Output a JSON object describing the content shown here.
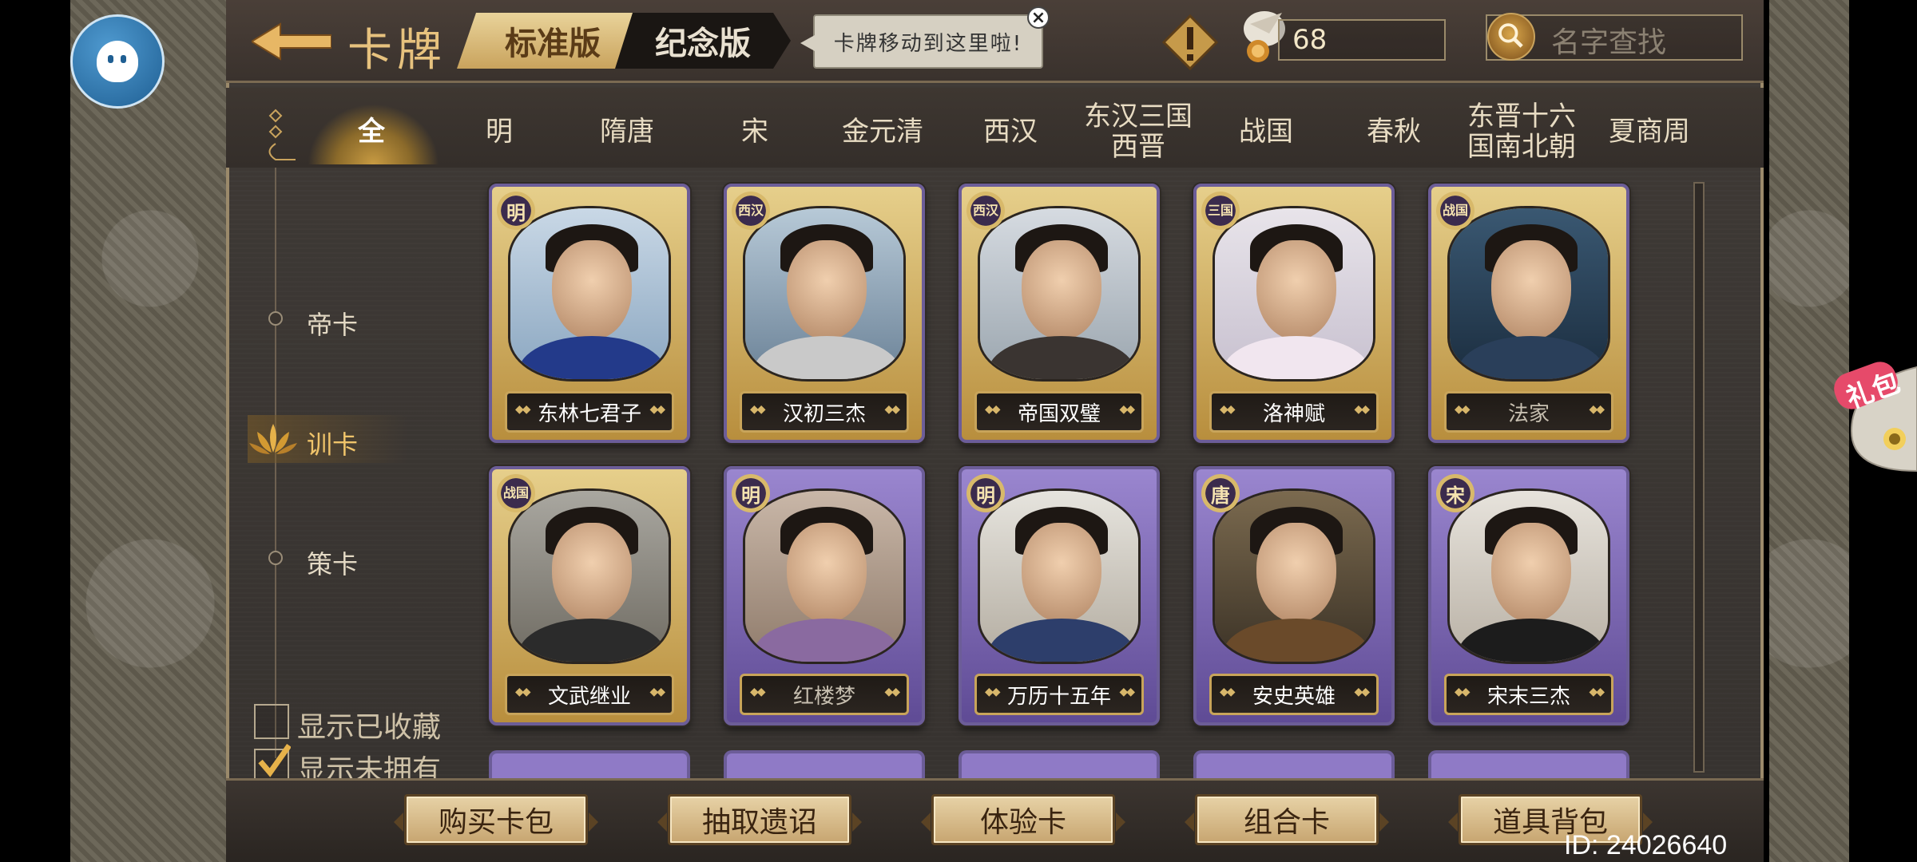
{
  "header": {
    "title": "卡牌",
    "tab_standard": "标准版",
    "tab_memorial": "纪念版",
    "tooltip": "卡牌移动到这里啦!",
    "currency_value": "68",
    "search_placeholder": "名字查找"
  },
  "dynasty_tabs": [
    "全",
    "明",
    "隋唐",
    "宋",
    "金元清",
    "西汉",
    "东汉三国\n西晋",
    "战国",
    "春秋",
    "东晋十六\n国南北朝",
    "夏商周"
  ],
  "categories": [
    "帝卡",
    "训卡",
    "策卡"
  ],
  "filters": {
    "show_collected": "显示已收藏",
    "show_unowned": "显示未拥有"
  },
  "cards": [
    {
      "label": "东林七君子",
      "badge": "明",
      "style": "gold"
    },
    {
      "label": "汉初三杰",
      "badge": "西汉",
      "style": "gold"
    },
    {
      "label": "帝国双璧",
      "badge": "西汉",
      "style": "gold"
    },
    {
      "label": "洛神赋",
      "badge": "三国",
      "style": "gold"
    },
    {
      "label": "法家",
      "badge": "战国",
      "style": "gold"
    },
    {
      "label": "文武继业",
      "badge": "战国",
      "style": "gold"
    },
    {
      "label": "红楼梦",
      "badge": "明",
      "style": "purple"
    },
    {
      "label": "万历十五年",
      "badge": "明",
      "style": "purple"
    },
    {
      "label": "安史英雄",
      "badge": "唐",
      "style": "purple"
    },
    {
      "label": "宋末三杰",
      "badge": "宋",
      "style": "purple"
    }
  ],
  "bottom_buttons": [
    "购买卡包",
    "抽取遗诏",
    "体验卡",
    "组合卡",
    "道具背包"
  ],
  "user_id": "ID: 24026640",
  "gift_label": "礼包",
  "colors": {
    "accent_gold": "#e7c27e",
    "card_gold": "#c89b42",
    "card_purple": "#6c5d98"
  }
}
